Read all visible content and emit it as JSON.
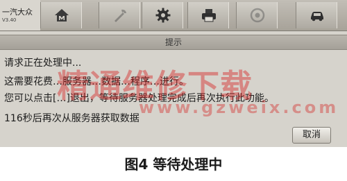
{
  "app": {
    "brand": "一汽大众",
    "version": "V3.40"
  },
  "toolbar": {
    "buttons": [
      {
        "id": "home",
        "icon": "home-icon",
        "enabled": true
      },
      {
        "id": "settings-disabled",
        "icon": "tools-icon",
        "enabled": false
      },
      {
        "id": "settings",
        "icon": "gear-icon",
        "enabled": true
      },
      {
        "id": "print",
        "icon": "printer-icon",
        "enabled": true
      },
      {
        "id": "help",
        "icon": "help-icon",
        "enabled": false
      },
      {
        "id": "car",
        "icon": "car-icon",
        "enabled": true
      }
    ]
  },
  "dialog": {
    "title": "提示",
    "processing": "请求正在处理中...",
    "line2": "这需要花费…服务器…数据…程序…进行。",
    "line3": "您可以点击[…]退出，等待服务器处理完成后再次执行此功能。",
    "countdown": "116秒后再次从服务器获取数据",
    "cancel_label": "取消"
  },
  "watermark": {
    "main": "精通维修下载",
    "url": "www.gzweix.com"
  },
  "caption": "图4 等待处理中",
  "colors": {
    "screen_bg": "#d6d3cc",
    "toolbar": "#a7a299",
    "watermark": "#d61c1c"
  }
}
